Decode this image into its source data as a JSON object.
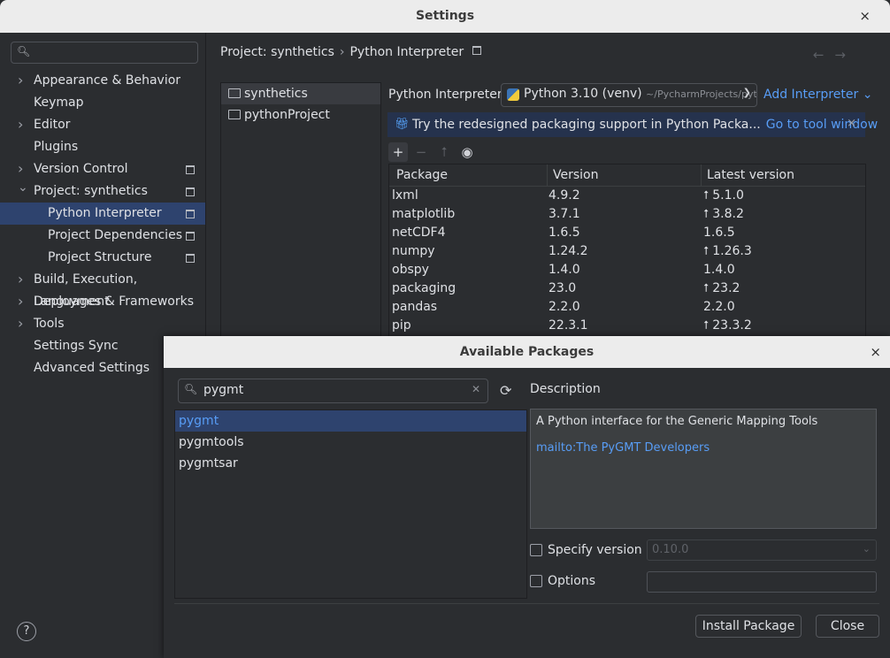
{
  "window": {
    "title": "Settings",
    "close_icon": "×"
  },
  "sidebar": {
    "search_placeholder": "",
    "items": [
      {
        "label": "Appearance & Behavior",
        "expandable": true
      },
      {
        "label": "Keymap"
      },
      {
        "label": "Editor",
        "expandable": true
      },
      {
        "label": "Plugins"
      },
      {
        "label": "Version Control",
        "expandable": true,
        "project_icon": true
      },
      {
        "label": "Project: synthetics",
        "expanded": true,
        "project_icon": true
      },
      {
        "label": "Python Interpreter",
        "sub": true,
        "selected": true,
        "project_icon": true
      },
      {
        "label": "Project Dependencies",
        "sub": true,
        "project_icon": true
      },
      {
        "label": "Project Structure",
        "sub": true,
        "project_icon": true
      },
      {
        "label": "Build, Execution, Deployment",
        "expandable": true
      },
      {
        "label": "Languages & Frameworks",
        "expandable": true
      },
      {
        "label": "Tools",
        "expandable": true
      },
      {
        "label": "Settings Sync"
      },
      {
        "label": "Advanced Settings"
      }
    ],
    "help": "?"
  },
  "breadcrumb": {
    "parent": "Project: synthetics",
    "sep": "›",
    "current": "Python Interpreter"
  },
  "nav_arrows": "←→",
  "projects": [
    {
      "name": "synthetics",
      "selected": true
    },
    {
      "name": "pythonProject"
    }
  ],
  "interpreter": {
    "label": "Python Interpreter:",
    "value": "Python 3.10 (venv)",
    "path": "~/PycharmProjects/pyt",
    "add_label": "Add Interpreter",
    "add_chevron": "⌄"
  },
  "banner": {
    "text": "Try the redesigned packaging support in Python Packa...",
    "link": "Go to tool window",
    "close": "×"
  },
  "toolbar": {
    "add": "+",
    "remove": "−",
    "upgrade": "⭡",
    "show": "◉"
  },
  "packages": {
    "headers": [
      "Package",
      "Version",
      "Latest version"
    ],
    "rows": [
      {
        "name": "lxml",
        "version": "4.9.2",
        "latest": "5.1.0",
        "upgrade": true
      },
      {
        "name": "matplotlib",
        "version": "3.7.1",
        "latest": "3.8.2",
        "upgrade": true
      },
      {
        "name": "netCDF4",
        "version": "1.6.5",
        "latest": "1.6.5",
        "upgrade": false
      },
      {
        "name": "numpy",
        "version": "1.24.2",
        "latest": "1.26.3",
        "upgrade": true
      },
      {
        "name": "obspy",
        "version": "1.4.0",
        "latest": "1.4.0",
        "upgrade": false
      },
      {
        "name": "packaging",
        "version": "23.0",
        "latest": "23.2",
        "upgrade": true
      },
      {
        "name": "pandas",
        "version": "2.2.0",
        "latest": "2.2.0",
        "upgrade": false
      },
      {
        "name": "pip",
        "version": "22.3.1",
        "latest": "23.3.2",
        "upgrade": true
      }
    ]
  },
  "dialog": {
    "title": "Available Packages",
    "close_icon": "×",
    "search_value": "pygmt",
    "results": [
      {
        "name": "pygmt",
        "selected": true
      },
      {
        "name": "pygmtools"
      },
      {
        "name": "pygmtsar"
      }
    ],
    "description_label": "Description",
    "description_text": "A Python interface for the Generic Mapping Tools",
    "description_link": "mailto:The PyGMT Developers",
    "specify_version_label": "Specify version",
    "version_value": "0.10.0",
    "options_label": "Options",
    "install_button": "Install Package",
    "close_button": "Close"
  }
}
